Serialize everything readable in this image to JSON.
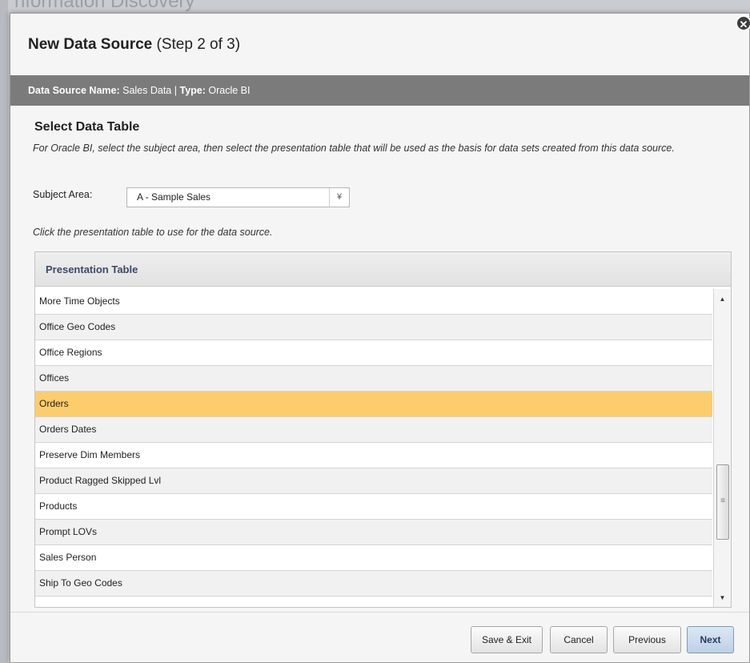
{
  "background": {
    "app_title": "nformation Discovery"
  },
  "dialog": {
    "title_bold": "New Data Source",
    "title_step": "(Step 2 of 3)",
    "close_icon": "close-icon",
    "info_bar": {
      "name_label": "Data Source Name:",
      "name_value": "Sales Data",
      "separator": "|",
      "type_label": "Type:",
      "type_value": "Oracle BI"
    },
    "section_title": "Select Data Table",
    "instructions": "For Oracle BI, select the subject area, then select the presentation table that will be used as the basis for data sets created from this data source.",
    "subject_area": {
      "label": "Subject Area:",
      "selected": "A - Sample Sales",
      "arrow_icon": "double-chevron-down-icon"
    },
    "click_hint": "Click the presentation table to use for the data source.",
    "table": {
      "header": "Presentation Table",
      "rows": [
        "More Time Objects",
        "Office Geo Codes",
        "Office Regions",
        "Offices",
        "Orders",
        "Orders Dates",
        "Preserve Dim Members",
        "Product Ragged Skipped Lvl",
        "Products",
        "Prompt LOVs",
        "Sales Person",
        "Ship To Geo Codes"
      ],
      "selected_row": "Orders",
      "scroll_position_fraction": 0.6
    },
    "buttons": {
      "save_exit": "Save & Exit",
      "cancel": "Cancel",
      "previous": "Previous",
      "next": "Next"
    }
  },
  "colors": {
    "info_bar": "#7b7b7b",
    "selected_row": "#fbcd6c",
    "header_text": "#3b4a6b"
  }
}
